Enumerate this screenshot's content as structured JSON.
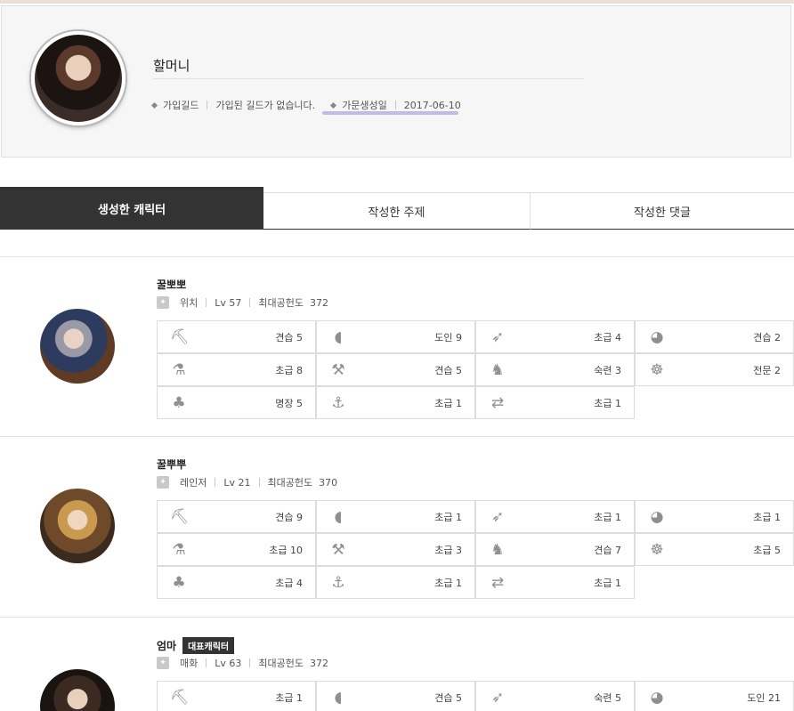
{
  "profile": {
    "name": "할머니",
    "guild_label": "가입길드",
    "guild_value": "가입된 길드가 없습니다.",
    "founded_label": "가문생성일",
    "founded_value": "2017-06-10"
  },
  "tabs": [
    {
      "label": "생성한 캐릭터"
    },
    {
      "label": "작성한 주제"
    },
    {
      "label": "작성한 댓글"
    }
  ],
  "level_prefix": "Lv",
  "contribution_label": "최대공헌도",
  "characters": [
    {
      "name": "꿀뽀뽀",
      "class": "위치",
      "level": "57",
      "contribution": "372",
      "skills": [
        "견습 5",
        "도인 9",
        "초급 4",
        "견습 2",
        "초급 8",
        "견습 5",
        "숙련 3",
        "전문 2",
        "명장 5",
        "초급 1",
        "초급 1"
      ]
    },
    {
      "name": "꿀뿌뿌",
      "class": "레인저",
      "level": "21",
      "contribution": "370",
      "skills": [
        "견습 9",
        "초급 1",
        "초급 1",
        "초급 1",
        "초급 10",
        "초급 3",
        "견습 7",
        "초급 5",
        "초급 4",
        "초급 1",
        "초급 1"
      ]
    },
    {
      "name": "엄마",
      "badge": "대표캐릭터",
      "class": "매화",
      "level": "63",
      "contribution": "372",
      "skills": [
        "초급 1",
        "견습 5",
        "숙련 5",
        "도인 21"
      ]
    }
  ],
  "skill_icons": [
    "gathering-icon",
    "fishing-icon",
    "hunting-icon",
    "cooking-icon",
    "alchemy-icon",
    "processing-icon",
    "training-icon",
    "trading-icon",
    "farming-icon",
    "sailing-icon",
    "bartering-icon"
  ]
}
